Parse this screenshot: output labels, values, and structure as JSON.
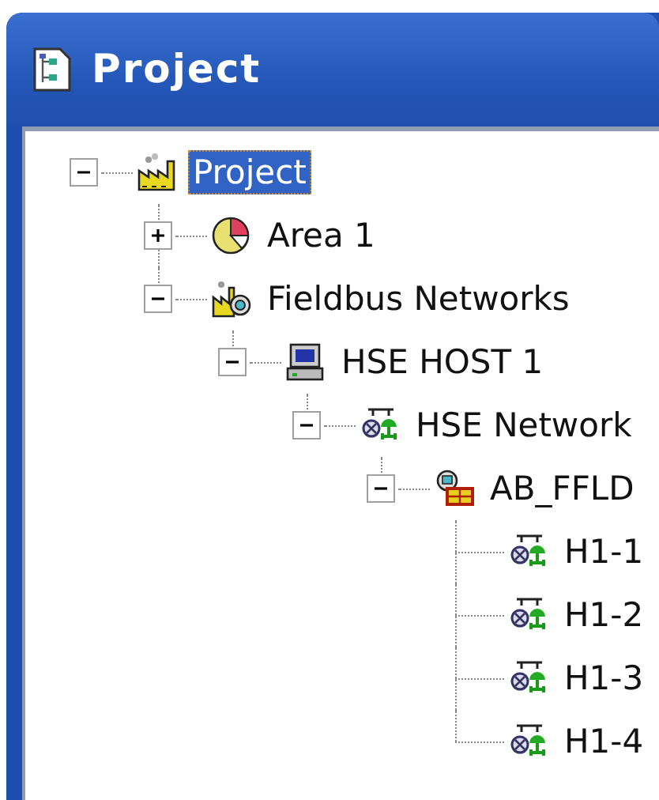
{
  "window": {
    "title": "Project"
  },
  "tree": [
    {
      "label": "Project",
      "kind": "project",
      "selected": true,
      "expanded": true,
      "children": [
        {
          "label": "Area 1",
          "kind": "area",
          "selected": false,
          "expanded": false
        },
        {
          "label": "Fieldbus Networks",
          "kind": "fieldbus",
          "selected": false,
          "expanded": true,
          "children": [
            {
              "label": "HSE HOST 1",
              "kind": "host",
              "selected": false,
              "expanded": true,
              "children": [
                {
                  "label": "HSE Network",
                  "kind": "network",
                  "selected": false,
                  "expanded": true,
                  "children": [
                    {
                      "label": "AB_FFLD",
                      "kind": "bridge",
                      "selected": false,
                      "expanded": true,
                      "children": [
                        {
                          "label": "H1-1",
                          "kind": "network",
                          "selected": false
                        },
                        {
                          "label": "H1-2",
                          "kind": "network",
                          "selected": false
                        },
                        {
                          "label": "H1-3",
                          "kind": "network",
                          "selected": false
                        },
                        {
                          "label": "H1-4",
                          "kind": "network",
                          "selected": false
                        }
                      ]
                    }
                  ]
                }
              ]
            }
          ]
        }
      ]
    }
  ]
}
